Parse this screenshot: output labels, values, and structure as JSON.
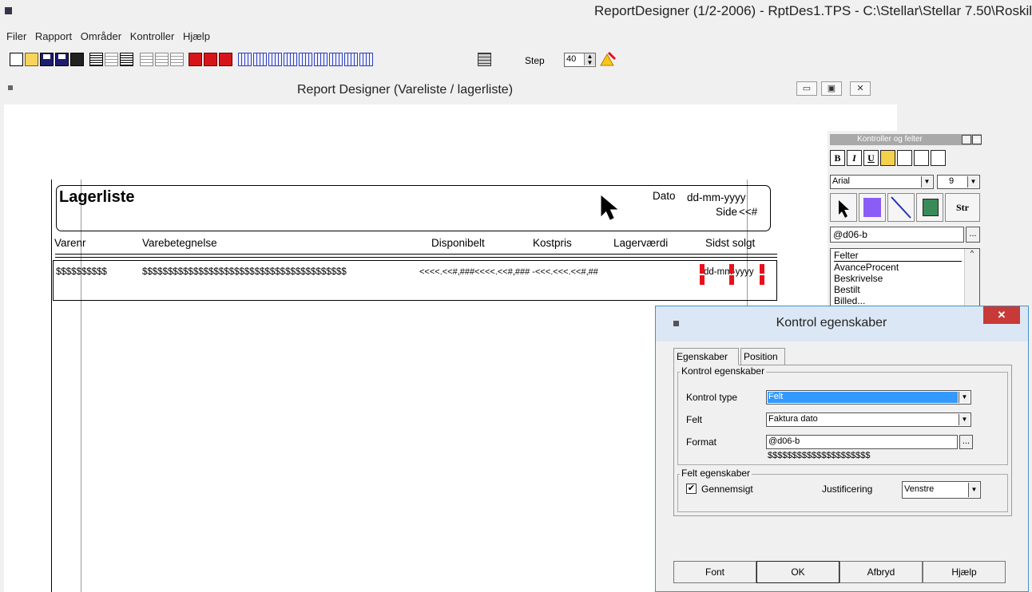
{
  "app": {
    "title": "ReportDesigner (1/2-2006) - RptDes1.TPS - C:\\Stellar\\Stellar 7.50\\Roskil"
  },
  "menu": [
    "Filer",
    "Rapport",
    "Områder",
    "Kontroller",
    "Hjælp"
  ],
  "toolbar": {
    "step_label": "Step",
    "step_value": "40"
  },
  "mdi": {
    "title": "Report Designer (Vareliste / lagerliste)"
  },
  "report": {
    "title": "Lagerliste",
    "dato_label": "Dato",
    "dato_value": "dd-mm-yyyy",
    "side_label": "Side",
    "side_value": "<<#",
    "columns": [
      "Varenr",
      "Varebetegnelse",
      "Disponibelt",
      "Kostpris",
      "Lagerværdi",
      "Sidst solgt"
    ],
    "detail": {
      "varenr": "$$$$$$$$$$",
      "varebetegnelse": "$$$$$$$$$$$$$$$$$$$$$$$$$$$$$$$$$$$$$$$$",
      "numbers": "<<<<.<<#,###<<<<.<<#,### -<<<.<<<.<<#,##",
      "sidst_solgt": "dd-mm-yyyy"
    }
  },
  "controls_panel": {
    "title": "Kontroller og felter",
    "font": "Arial",
    "size": "9",
    "str_label": "Str",
    "format_field": "@d06-b",
    "list_header": "Felter",
    "list_items": [
      "AvanceProcent",
      "Beskrivelse",
      "Bestilt",
      "Billed..."
    ]
  },
  "dialog": {
    "title": "Kontrol egenskaber",
    "tabs": [
      "Egenskaber",
      "Position"
    ],
    "group1_label": "Kontrol egenskaber",
    "kontrol_type_label": "Kontrol type",
    "kontrol_type_value": "Felt",
    "felt_label": "Felt",
    "felt_value": "Faktura dato",
    "format_label": "Format",
    "format_value": "@d06-b",
    "format_preview": "$$$$$$$$$$$$$$$$$$$$$",
    "group2_label": "Felt egenskaber",
    "gennemsigt_label": "Gennemsigt",
    "justificering_label": "Justificering",
    "justificering_value": "Venstre",
    "buttons": [
      "Font",
      "OK",
      "Afbryd",
      "Hjælp"
    ]
  },
  "colors": {
    "selection_blue": "#3399ff",
    "handle_red": "#e8101a",
    "close_red": "#c83a37",
    "tool_blue": "#8b5cf6"
  }
}
